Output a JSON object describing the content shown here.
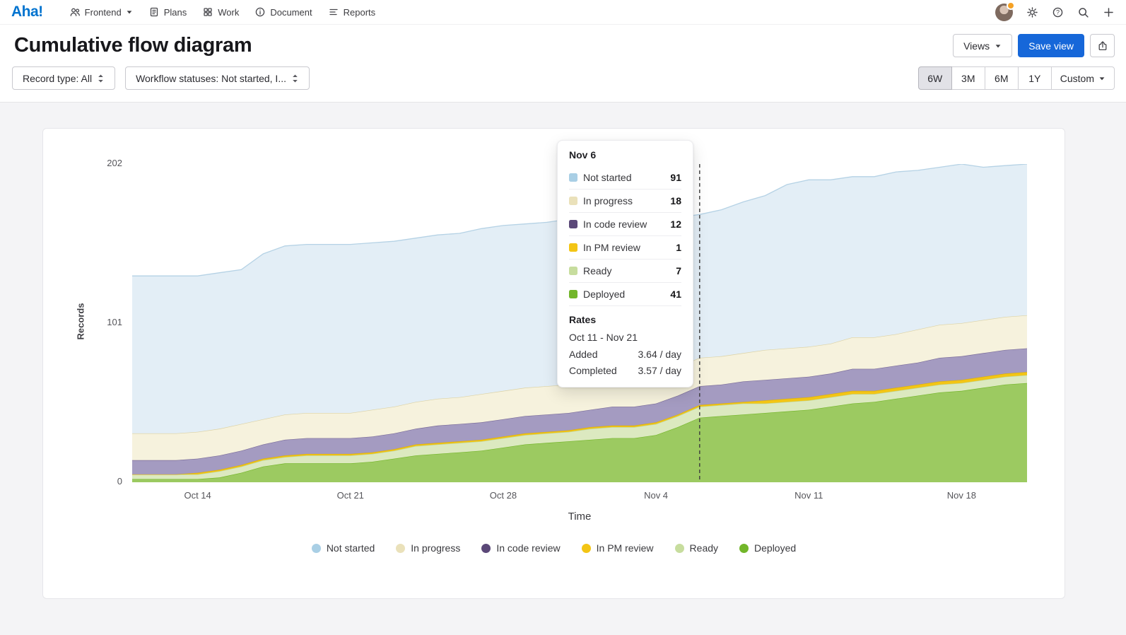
{
  "nav": {
    "logo": "Aha!",
    "workspace": "Frontend",
    "items": [
      {
        "label": "Plans"
      },
      {
        "label": "Work"
      },
      {
        "label": "Document"
      },
      {
        "label": "Reports"
      }
    ]
  },
  "header": {
    "title": "Cumulative flow diagram",
    "views_label": "Views",
    "save_view_label": "Save view"
  },
  "filters": {
    "record_type": "Record type: All",
    "workflow_statuses": "Workflow statuses: Not started, I...",
    "ranges": [
      "6W",
      "3M",
      "6M",
      "1Y"
    ],
    "custom_label": "Custom",
    "selected_range": "6W"
  },
  "chart_data": {
    "type": "area",
    "stacked": true,
    "ylabel": "Records",
    "xlabel": "Time",
    "ylim": [
      0,
      202
    ],
    "yticks": [
      0,
      101,
      202
    ],
    "x_range": [
      "Oct 11",
      "Nov 21"
    ],
    "x_ticks": [
      {
        "index": 3,
        "label": "Oct 14"
      },
      {
        "index": 10,
        "label": "Oct 21"
      },
      {
        "index": 17,
        "label": "Oct 28"
      },
      {
        "index": 24,
        "label": "Nov 4"
      },
      {
        "index": 31,
        "label": "Nov 11"
      },
      {
        "index": 38,
        "label": "Nov 18"
      }
    ],
    "marker": {
      "index": 26,
      "label": "Nov 6"
    },
    "legend_order": [
      "Not started",
      "In progress",
      "In code review",
      "In PM review",
      "Ready",
      "Deployed"
    ],
    "series": [
      {
        "name": "Deployed",
        "dot": "#72b62a",
        "fill": "#9cca61",
        "line": "#74b62a",
        "values": [
          2,
          2,
          2,
          2,
          3,
          6,
          10,
          12,
          12,
          12,
          12,
          13,
          15,
          17,
          18,
          19,
          20,
          22,
          24,
          25,
          26,
          27,
          28,
          28,
          30,
          35,
          41,
          42,
          43,
          44,
          45,
          46,
          48,
          50,
          51,
          53,
          55,
          57,
          58,
          60,
          62,
          63
        ]
      },
      {
        "name": "Ready",
        "dot": "#c7dd9e",
        "fill": "#dce9c0",
        "line": "#bdd591",
        "values": [
          3,
          3,
          3,
          3,
          4,
          4,
          4,
          4,
          5,
          5,
          5,
          5,
          5,
          6,
          6,
          6,
          6,
          6,
          6,
          6,
          6,
          7,
          7,
          7,
          7,
          7,
          7,
          7,
          7,
          6,
          6,
          6,
          6,
          6,
          5,
          5,
          5,
          5,
          5,
          5,
          5,
          5
        ]
      },
      {
        "name": "In PM review",
        "dot": "#f3c515",
        "fill": "#f3c515",
        "line": "#dcb005",
        "values": [
          0,
          0,
          0,
          1,
          1,
          1,
          1,
          1,
          1,
          1,
          1,
          1,
          1,
          1,
          1,
          1,
          1,
          1,
          1,
          1,
          1,
          1,
          1,
          1,
          1,
          1,
          1,
          1,
          1,
          2,
          2,
          2,
          2,
          2,
          2,
          2,
          2,
          2,
          2,
          2,
          2,
          2
        ]
      },
      {
        "name": "In code review",
        "dot": "#5b4878",
        "fill": "#a49bc1",
        "line": "#7b6d99",
        "values": [
          9,
          9,
          9,
          9,
          9,
          9,
          9,
          10,
          10,
          10,
          10,
          10,
          10,
          10,
          11,
          11,
          11,
          11,
          11,
          11,
          11,
          11,
          12,
          12,
          12,
          12,
          12,
          12,
          13,
          13,
          13,
          13,
          13,
          14,
          14,
          14,
          14,
          15,
          15,
          15,
          15,
          15
        ]
      },
      {
        "name": "In progress",
        "dot": "#eae1ba",
        "fill": "#f6f2dd",
        "line": "#dcd2a4",
        "values": [
          17,
          17,
          17,
          17,
          17,
          17,
          16,
          16,
          16,
          16,
          16,
          17,
          17,
          17,
          17,
          17,
          18,
          18,
          18,
          18,
          18,
          18,
          18,
          18,
          18,
          18,
          18,
          18,
          18,
          19,
          19,
          19,
          19,
          20,
          20,
          20,
          21,
          21,
          21,
          21,
          21,
          21
        ]
      },
      {
        "name": "Not started",
        "dot": "#a9cfe5",
        "fill": "#e3eef6",
        "line": "#b5d2e5",
        "values": [
          100,
          100,
          100,
          99,
          99,
          98,
          105,
          107,
          107,
          107,
          107,
          106,
          105,
          104,
          104,
          104,
          105,
          105,
          104,
          104,
          105,
          104,
          103,
          103,
          100,
          95,
          91,
          93,
          96,
          98,
          104,
          106,
          104,
          102,
          102,
          103,
          101,
          100,
          101,
          97,
          96,
          96
        ]
      }
    ]
  },
  "tooltip": {
    "title": "Nov 6",
    "rows": [
      {
        "label": "Not started",
        "value": "91",
        "color": "#a9cfe5"
      },
      {
        "label": "In progress",
        "value": "18",
        "color": "#eae1ba"
      },
      {
        "label": "In code review",
        "value": "12",
        "color": "#5b4878"
      },
      {
        "label": "In PM review",
        "value": "1",
        "color": "#f3c515"
      },
      {
        "label": "Ready",
        "value": "7",
        "color": "#c7dd9e"
      },
      {
        "label": "Deployed",
        "value": "41",
        "color": "#72b62a"
      }
    ],
    "rates_label": "Rates",
    "range": "Oct 11 - Nov 21",
    "added_label": "Added",
    "added_value": "3.64 / day",
    "completed_label": "Completed",
    "completed_value": "3.57 / day"
  }
}
